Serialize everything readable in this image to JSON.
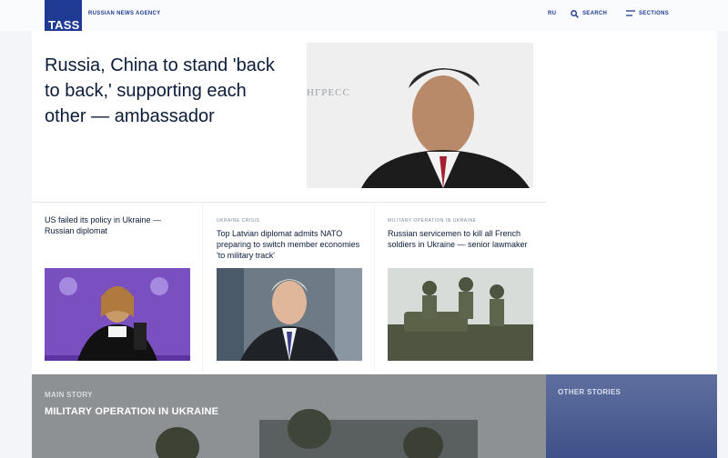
{
  "header": {
    "logo_text": "TASS",
    "agency": "RUSSIAN NEWS AGENCY",
    "lang": "RU",
    "search_label": "SEARCH",
    "sections_label": "SECTIONS"
  },
  "hero": {
    "title": "Russia, China to stand 'back to back,' supporting each other — ambassador"
  },
  "cards": [
    {
      "tag": "",
      "title": "US failed its policy in Ukraine — Russian diplomat"
    },
    {
      "tag": "UKRAINE CRISIS",
      "title": "Top Latvian diplomat admits NATO preparing to switch member economies 'to military track'"
    },
    {
      "tag": "MILITARY OPERATION IN UKRAINE",
      "title": "Russian servicemen to kill all French soldiers in Ukraine — senior lawmaker"
    }
  ],
  "bottom": {
    "main_story": "MAIN STORY",
    "main_title": "MILITARY OPERATION IN UKRAINE",
    "other_stories": "OTHER STORIES"
  },
  "colors": {
    "brand_blue": "#1f3a93",
    "page_bg": "#f4f5f8"
  },
  "icons": [
    "search-icon",
    "menu-icon"
  ]
}
